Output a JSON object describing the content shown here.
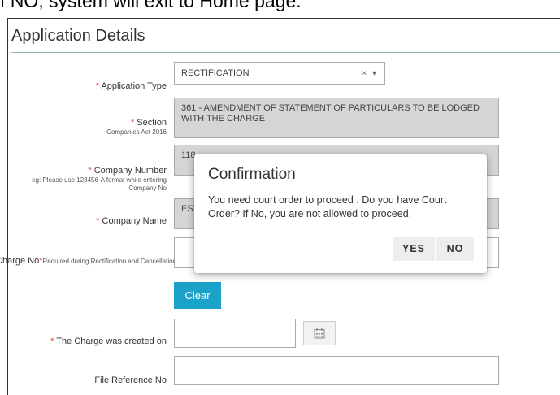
{
  "caption": "f NO, system will exit to Home page.",
  "panel": {
    "title": "Application Details"
  },
  "fields": {
    "application_type": {
      "label": "Application Type",
      "value": "RECTIFICATION",
      "controls": "× ▾"
    },
    "section": {
      "label": "Section",
      "sub": "Companies Act 2016",
      "value": "361 - AMENDMENT OF STATEMENT OF PARTICULARS TO BE LODGED WITH THE CHARGE"
    },
    "company_number": {
      "label": "Company Number",
      "sub": "eg: Please use 123456-A format while entering Company No",
      "value": "118"
    },
    "company_name": {
      "label": "Company Name",
      "value": "EST"
    },
    "charge_no": {
      "label": "Charge No",
      "sub": "Required during Rectification and Cancellation",
      "value": ""
    },
    "clear_label": "Clear",
    "charge_created_on": {
      "label": "The Charge was created on",
      "value": ""
    },
    "file_reference_no": {
      "label": "File Reference No",
      "value": ""
    }
  },
  "dialog": {
    "title": "Confirmation",
    "message": "You need court order to proceed . Do you have Court Order? If No, you are not allowed to proceed.",
    "yes_label": "YES",
    "no_label": "NO"
  },
  "icons": {
    "calendar": "calendar-icon"
  }
}
